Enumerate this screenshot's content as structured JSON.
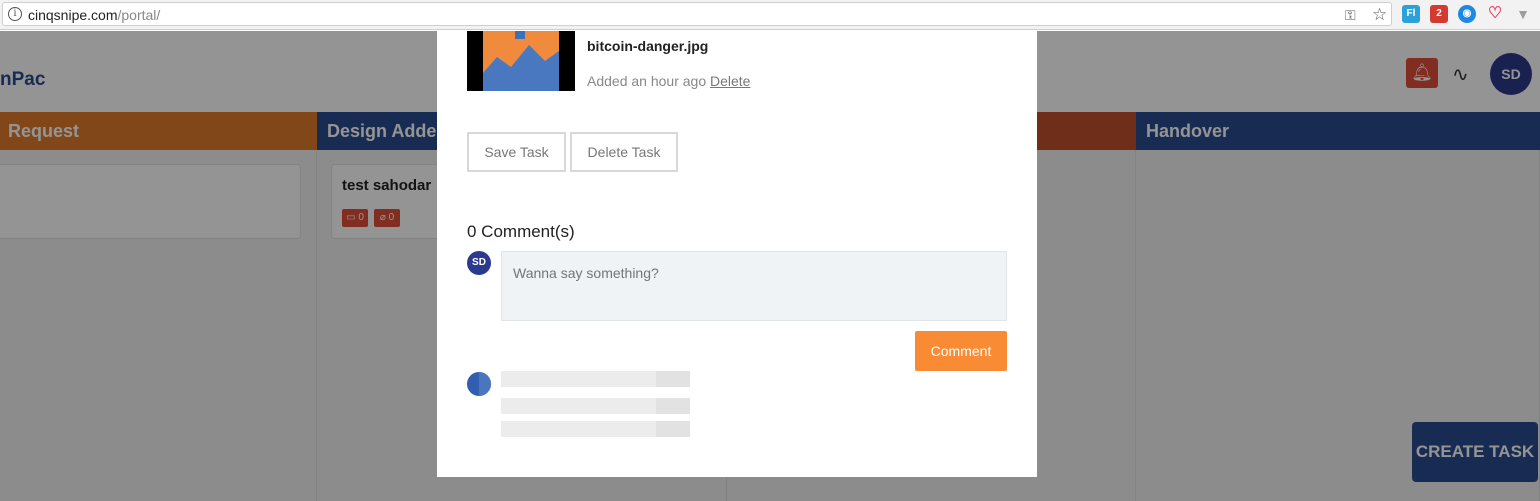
{
  "browser": {
    "url_host": "cinqsnipe.com",
    "url_path": "/portal/",
    "extensions": [
      {
        "name": "fl-extension",
        "label": "Fl",
        "color": "#2ea0d8"
      },
      {
        "name": "calendar-extension",
        "label": "2",
        "color": "#d23b2f"
      },
      {
        "name": "eye-extension",
        "label": "",
        "color": "#1e88e5"
      },
      {
        "name": "heart-extension",
        "label": "",
        "color": "#e6456c"
      },
      {
        "name": "v-extension",
        "label": "",
        "color": "#9e9e9e"
      }
    ]
  },
  "header": {
    "brand": "nPac",
    "avatar_initials": "SD"
  },
  "columns": [
    {
      "title": "Request",
      "color": "#e07b2a"
    },
    {
      "title": "Design Added",
      "color": "#2a4d8f"
    },
    {
      "title": "",
      "color": "#c0502c"
    },
    {
      "title": "Handover",
      "color": "#2a4d8f"
    }
  ],
  "cards": [
    {
      "title": "test sahodar",
      "comments": "0",
      "attachments": "0"
    }
  ],
  "create_task_label": "CREATE TASK",
  "modal": {
    "attachment": {
      "file_name": "bitcoin-danger.jpg",
      "added": "Added an hour ago",
      "delete_label": "Delete"
    },
    "save_task_label": "Save Task",
    "delete_task_label": "Delete Task",
    "comments_title": "0 Comment(s)",
    "comment_avatar": "SD",
    "comment_placeholder": "Wanna say something?",
    "comment_button": "Comment"
  }
}
